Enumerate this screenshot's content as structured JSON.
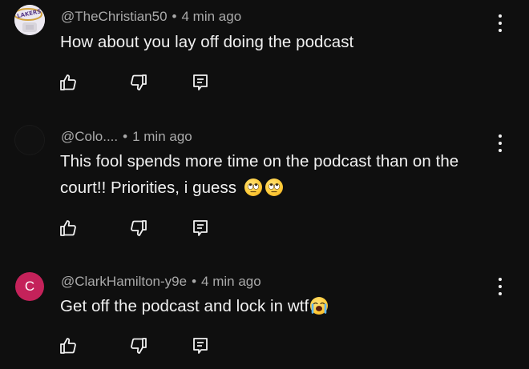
{
  "comments": [
    {
      "handle": "@TheChristian50",
      "separator": "•",
      "time": "4 min ago",
      "text": "How about you lay off doing the podcast",
      "emojis": [],
      "avatar": {
        "kind": "logo",
        "logo_text": "LAKERS"
      }
    },
    {
      "handle": "@Colo....",
      "separator": "•",
      "time": "1 min ago",
      "text": "This fool spends more time on the podcast than on the court!! Priorities, i guess",
      "emojis": [
        "face-with-rolling-eyes",
        "face-with-rolling-eyes"
      ],
      "avatar": {
        "kind": "dark"
      }
    },
    {
      "handle": "@ClarkHamilton-y9e",
      "separator": "•",
      "time": "4 min ago",
      "text": "Get off the podcast and lock in wtf",
      "emojis": [
        "loudly-crying-face"
      ],
      "avatar": {
        "kind": "letter",
        "letter": "C",
        "color": "#c4225a"
      }
    }
  ],
  "actions": {
    "like_icon": "thumbs-up-icon",
    "dislike_icon": "thumbs-down-icon",
    "reply_icon": "reply-icon",
    "more_icon": "more-vertical-icon"
  },
  "colors": {
    "background": "#0f0f0f",
    "text": "#f1f1f1",
    "meta": "#aaaaaa",
    "avatar_c": "#c4225a"
  }
}
